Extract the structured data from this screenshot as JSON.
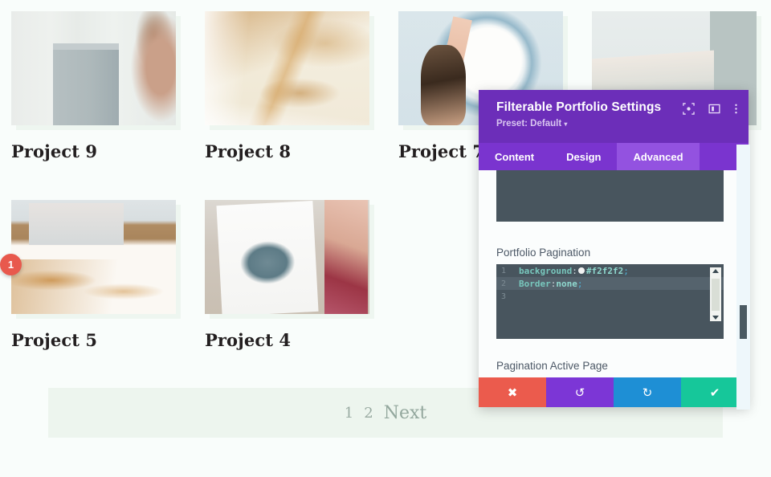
{
  "page": {
    "background_color": "#f9fdfb",
    "projects": [
      {
        "title": "Project 9",
        "art": "art-p9"
      },
      {
        "title": "Project 8",
        "art": "art-p8"
      },
      {
        "title": "Project 7",
        "art": "art-p7"
      },
      {
        "title": "",
        "art": "art-p6"
      },
      {
        "title": "Project 5",
        "art": "art-p5"
      },
      {
        "title": "Project 4",
        "art": "art-p4"
      }
    ],
    "pagination": {
      "band_color": "#edf5ee",
      "pages": [
        "1",
        "2"
      ],
      "next_label": "Next"
    }
  },
  "modal": {
    "title": "Filterable Portfolio Settings",
    "preset_label": "Preset: Default",
    "preset_caret": "▾",
    "header_color": "#6c2eb9",
    "tabbar_color": "#7a34cf",
    "active_tab_color": "#9352e0",
    "header_icons": [
      {
        "name": "focus-target-icon"
      },
      {
        "name": "layout-panel-icon"
      },
      {
        "name": "more-options-icon"
      }
    ],
    "tabs": [
      {
        "label": "Content",
        "active": false
      },
      {
        "label": "Design",
        "active": false
      },
      {
        "label": "Advanced",
        "active": true
      }
    ],
    "fields": {
      "pagination_label": "Portfolio Pagination",
      "active_page_label": "Pagination Active Page"
    },
    "code_editor": {
      "background": "#48555e",
      "lines": [
        {
          "number": "1",
          "property": "background",
          "colon": ":",
          "has_color_swatch": true,
          "swatch_color": "#f2f2f2",
          "value": "#f2f2f2",
          "semicolon": ";",
          "highlighted": false
        },
        {
          "number": "2",
          "property": "Border",
          "colon": ":",
          "has_color_swatch": false,
          "swatch_color": "",
          "value": "none",
          "semicolon": ";",
          "highlighted": true
        },
        {
          "number": "3",
          "property": "",
          "colon": "",
          "has_color_swatch": false,
          "swatch_color": "",
          "value": "",
          "semicolon": "",
          "highlighted": false
        }
      ]
    },
    "badge": {
      "number": "1",
      "color": "#e8594d"
    },
    "actions": [
      {
        "name": "cancel",
        "glyph": "✖",
        "color": "#eb5b4d"
      },
      {
        "name": "undo",
        "glyph": "↺",
        "color": "#7c36d6"
      },
      {
        "name": "redo",
        "glyph": "↻",
        "color": "#1e8fd5"
      },
      {
        "name": "save",
        "glyph": "✔",
        "color": "#16c79a"
      }
    ]
  }
}
